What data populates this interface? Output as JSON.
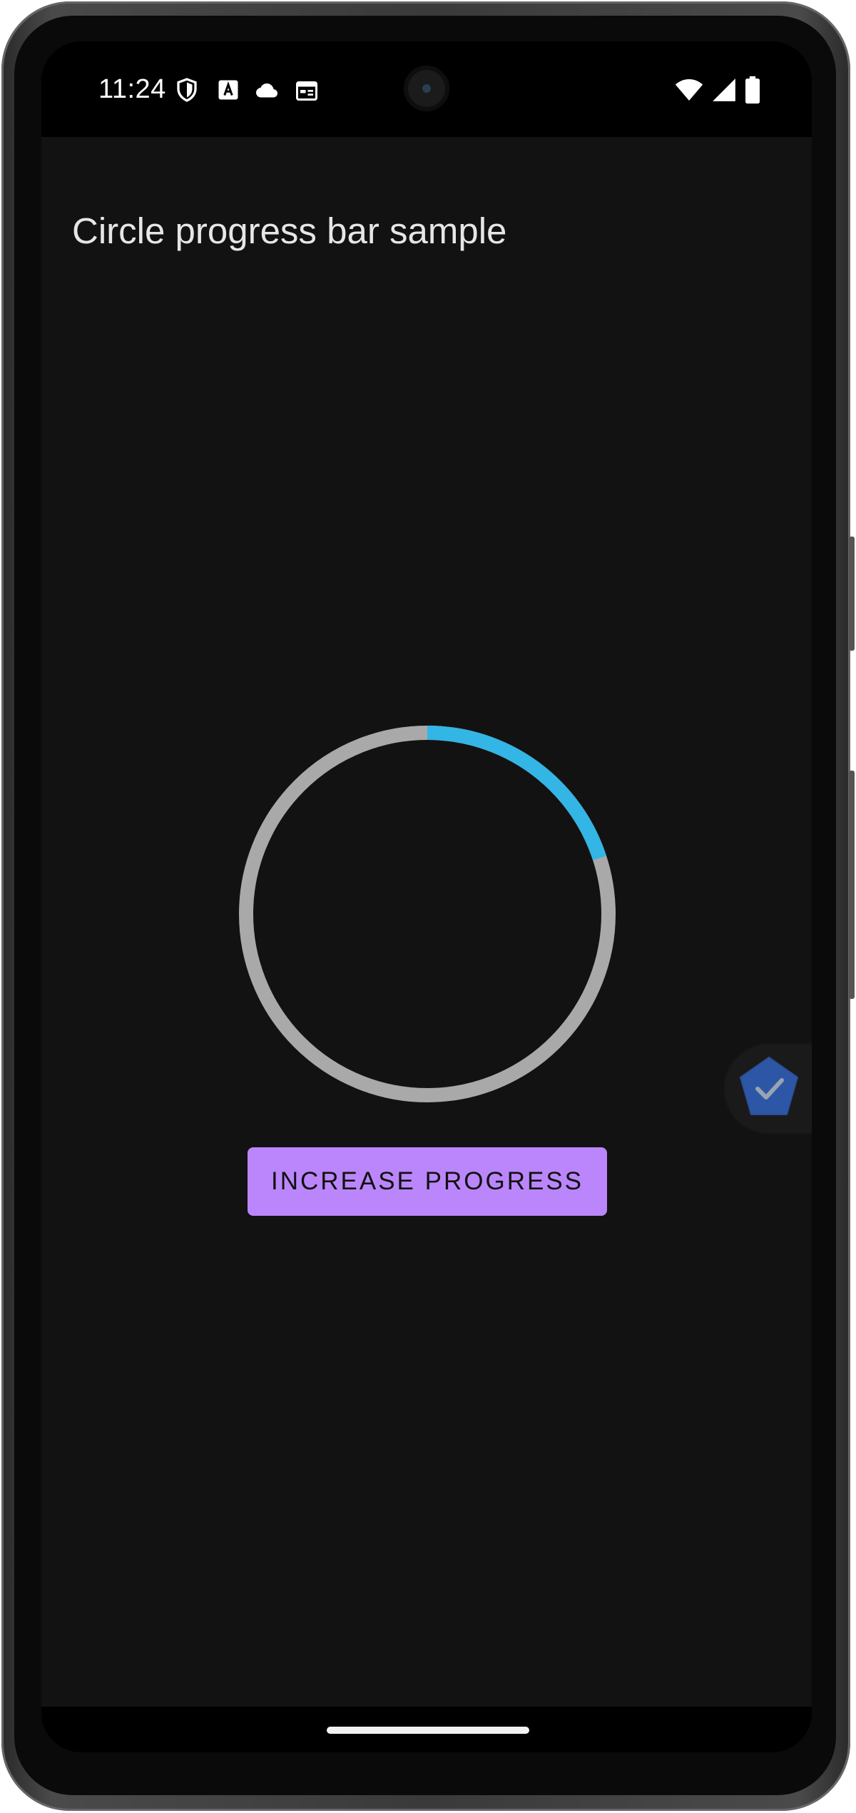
{
  "status_bar": {
    "time": "11:24",
    "left_icons": [
      "shield-icon",
      "text-a-icon",
      "cloud-icon",
      "calendar-icon"
    ],
    "right_icons": [
      "wifi-icon",
      "signal-icon",
      "battery-icon"
    ]
  },
  "app": {
    "title": "Circle progress bar sample",
    "progress": {
      "fraction": 0.2,
      "track_color": "#A9A9A9",
      "progress_color": "#33B5E5"
    },
    "increase_button_label": "INCREASE PROGRESS",
    "colors": {
      "background": "#121212",
      "button": "#BB86FC",
      "floating_bubble": "#2D57A6"
    }
  },
  "floating_bubble": {
    "icon": "pentagon-check-icon"
  }
}
